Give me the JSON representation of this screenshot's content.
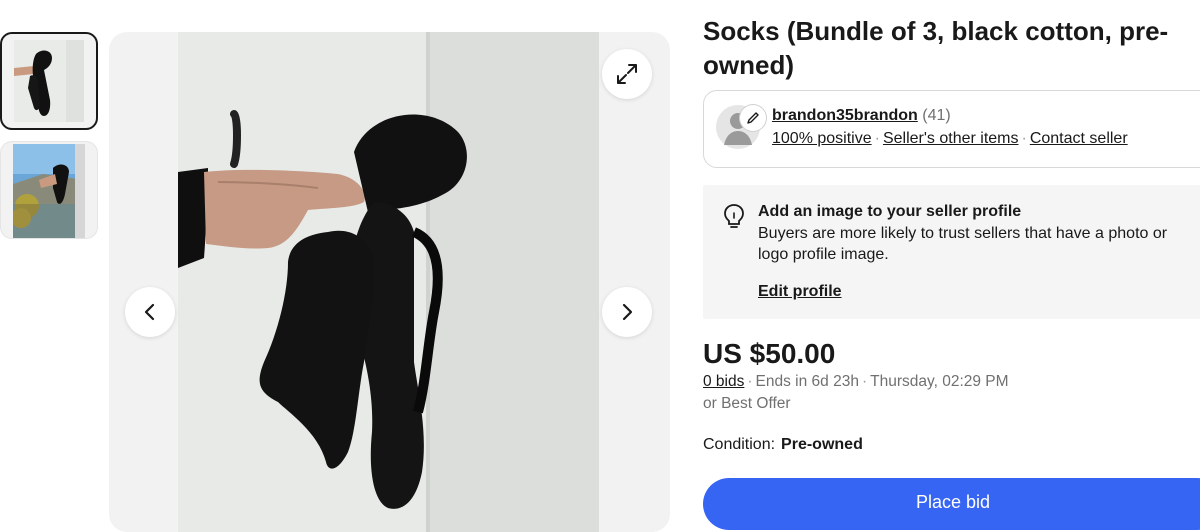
{
  "listing": {
    "title": "Socks (Bundle of 3, black cotton, pre-owned)"
  },
  "gallery": {
    "thumbnails": [
      {
        "icon": "thumbnail-socks-photo",
        "selected": true
      },
      {
        "icon": "thumbnail-socks-outdoor-photo",
        "selected": false
      }
    ],
    "icons": {
      "expand": "expand-icon",
      "prev": "chevron-left-icon",
      "next": "chevron-right-icon"
    }
  },
  "seller": {
    "name": "brandon35brandon",
    "feedback_count": "(41)",
    "positive": "100% positive",
    "other_items": "Seller's other items",
    "contact": "Contact seller",
    "separator": "·"
  },
  "tip": {
    "title": "Add an image to your seller profile",
    "body": "Buyers are more likely to trust sellers that have a photo or logo profile image.",
    "edit_link": "Edit profile"
  },
  "pricing": {
    "price": "US $50.00",
    "bids": "0 bids",
    "ends": "Ends in 6d 23h",
    "end_time": "Thursday, 02:29 PM",
    "best_offer": "or Best Offer"
  },
  "condition": {
    "label": "Condition:",
    "value": "Pre-owned"
  },
  "actions": {
    "place_bid": "Place bid"
  },
  "colors": {
    "primary_button": "#3665f3",
    "text": "#191919",
    "muted": "#707070",
    "gallery_bg": "#f2f2f2"
  }
}
